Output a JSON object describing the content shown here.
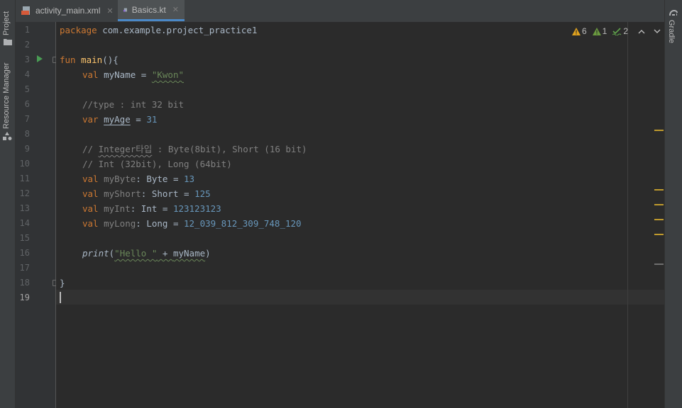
{
  "tabs": [
    {
      "label": "activity_main.xml",
      "active": false
    },
    {
      "label": "Basics.kt",
      "active": true
    }
  ],
  "left_tool_tabs": {
    "project": "Project",
    "resource_manager": "Resource Manager"
  },
  "right_tool_tabs": {
    "gradle": "Gradle"
  },
  "inspection": {
    "warnings": "6",
    "weak_warnings": "1",
    "typos": "2"
  },
  "line_numbers": [
    "1",
    "2",
    "3",
    "4",
    "5",
    "6",
    "7",
    "8",
    "9",
    "10",
    "11",
    "12",
    "13",
    "14",
    "15",
    "16",
    "17",
    "18",
    "19"
  ],
  "code": {
    "l1": {
      "kw": "package",
      "rest": " com.example.project_practice1"
    },
    "l3": {
      "kw": "fun",
      "fn": "main",
      "rest": "(){"
    },
    "l4": {
      "kw": "val",
      "name": " myName = ",
      "str": "\"Kwon\""
    },
    "l6": {
      "cmt": "//type : int 32 bit"
    },
    "l7": {
      "kw": "var",
      "name": "myAge",
      "op": " = ",
      "num": "31"
    },
    "l9": {
      "cmt1": "// ",
      "cmt_typo": "Integer타입",
      "cmt2": " : Byte(8bit), Short (16 bit)"
    },
    "l10": {
      "cmt": "// Int (32bit), Long (64bit)"
    },
    "l11": {
      "kw": "val",
      "name": " myByte",
      "type": ": Byte = ",
      "num": "13"
    },
    "l12": {
      "kw": "val",
      "name": " myShort",
      "type": ": Short = ",
      "num": "125"
    },
    "l13": {
      "kw": "val",
      "name": " myInt",
      "type": ": Int = ",
      "num": "123123123"
    },
    "l14": {
      "kw": "val",
      "name": " myLong",
      "type": ": Long = ",
      "num": "12_039_812_309_748_120"
    },
    "l16": {
      "fn": "print",
      "p1": "(",
      "str": "\"Hello \"",
      "op": " + ",
      "var": "myName",
      "p2": ")"
    },
    "l18": {
      "brace": "}"
    }
  },
  "colors": {
    "keyword": "#cc7832",
    "function": "#ffc66d",
    "string": "#6a8759",
    "number": "#6897bb",
    "comment": "#808080",
    "warning": "#e0a21e"
  }
}
